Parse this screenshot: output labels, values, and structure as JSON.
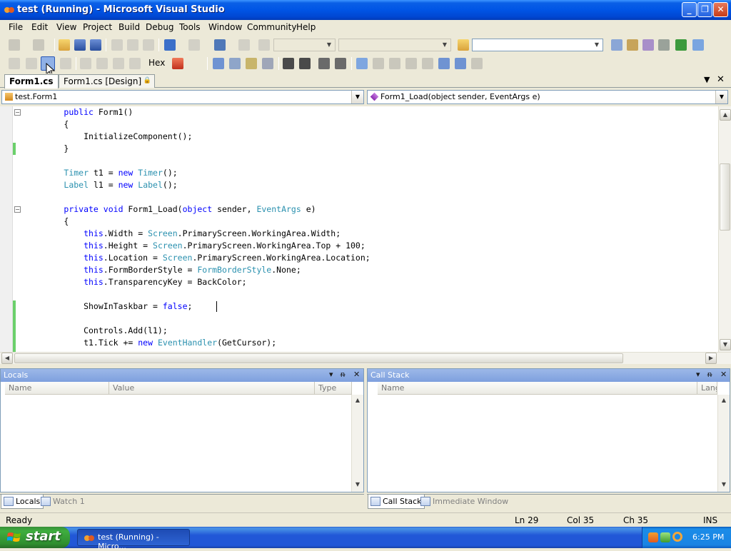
{
  "window": {
    "title": "test (Running) - Microsoft Visual Studio",
    "min_glyph": "_",
    "max_glyph": "❐",
    "close_glyph": "✕"
  },
  "menu": [
    "File",
    "Edit",
    "View",
    "Project",
    "Build",
    "Debug",
    "Tools",
    "Window",
    "Community",
    "Help"
  ],
  "debug_toolbar": {
    "hex_label": "Hex"
  },
  "document_tabs": [
    {
      "label": "Form1.cs",
      "active": true
    },
    {
      "label": "Form1.cs [Design]",
      "active": false
    }
  ],
  "navigation": {
    "class_combo": "test.Form1",
    "member_combo": "Form1_Load(object sender, EventArgs e)"
  },
  "code": [
    [
      {
        "t": "        "
      },
      {
        "t": "public",
        "c": "kw"
      },
      {
        "t": " Form1()"
      }
    ],
    [
      {
        "t": "        {"
      }
    ],
    [
      {
        "t": "            InitializeComponent();"
      }
    ],
    [
      {
        "t": "        }"
      }
    ],
    [
      {
        "t": ""
      }
    ],
    [
      {
        "t": "        "
      },
      {
        "t": "Timer",
        "c": "ty"
      },
      {
        "t": " t1 = "
      },
      {
        "t": "new",
        "c": "kw"
      },
      {
        "t": " "
      },
      {
        "t": "Timer",
        "c": "ty"
      },
      {
        "t": "();"
      }
    ],
    [
      {
        "t": "        "
      },
      {
        "t": "Label",
        "c": "ty"
      },
      {
        "t": " l1 = "
      },
      {
        "t": "new",
        "c": "kw"
      },
      {
        "t": " "
      },
      {
        "t": "Label",
        "c": "ty"
      },
      {
        "t": "();"
      }
    ],
    [
      {
        "t": ""
      }
    ],
    [
      {
        "t": "        "
      },
      {
        "t": "private",
        "c": "kw"
      },
      {
        "t": " "
      },
      {
        "t": "void",
        "c": "kw"
      },
      {
        "t": " Form1_Load("
      },
      {
        "t": "object",
        "c": "kw"
      },
      {
        "t": " sender, "
      },
      {
        "t": "EventArgs",
        "c": "ty"
      },
      {
        "t": " e)"
      }
    ],
    [
      {
        "t": "        {"
      }
    ],
    [
      {
        "t": "            "
      },
      {
        "t": "this",
        "c": "kw"
      },
      {
        "t": ".Width = "
      },
      {
        "t": "Screen",
        "c": "ty"
      },
      {
        "t": ".PrimaryScreen.WorkingArea.Width;"
      }
    ],
    [
      {
        "t": "            "
      },
      {
        "t": "this",
        "c": "kw"
      },
      {
        "t": ".Height = "
      },
      {
        "t": "Screen",
        "c": "ty"
      },
      {
        "t": ".PrimaryScreen.WorkingArea.Top + 100;"
      }
    ],
    [
      {
        "t": "            "
      },
      {
        "t": "this",
        "c": "kw"
      },
      {
        "t": ".Location = "
      },
      {
        "t": "Screen",
        "c": "ty"
      },
      {
        "t": ".PrimaryScreen.WorkingArea.Location;"
      }
    ],
    [
      {
        "t": "            "
      },
      {
        "t": "this",
        "c": "kw"
      },
      {
        "t": ".FormBorderStyle = "
      },
      {
        "t": "FormBorderStyle",
        "c": "ty"
      },
      {
        "t": ".None;"
      }
    ],
    [
      {
        "t": "            "
      },
      {
        "t": "this",
        "c": "kw"
      },
      {
        "t": ".TransparencyKey = BackColor;"
      }
    ],
    [
      {
        "t": ""
      }
    ],
    [
      {
        "t": "            ShowInTaskbar = "
      },
      {
        "t": "false",
        "c": "kw"
      },
      {
        "t": ";"
      }
    ],
    [
      {
        "t": ""
      }
    ],
    [
      {
        "t": "            Controls.Add(l1);"
      }
    ],
    [
      {
        "t": "            t1.Tick += "
      },
      {
        "t": "new",
        "c": "kw"
      },
      {
        "t": " "
      },
      {
        "t": "EventHandler",
        "c": "ty"
      },
      {
        "t": "(GetCursor);"
      }
    ]
  ],
  "locals_pane": {
    "title": "Locals",
    "columns": [
      "Name",
      "Value",
      "Type"
    ]
  },
  "callstack_pane": {
    "title": "Call Stack",
    "columns": [
      "Name",
      "Langu"
    ]
  },
  "pane_controls": {
    "dropdown": "▾",
    "pin": "ᵰ",
    "close": "✕"
  },
  "bottom_tabs_left": [
    {
      "label": "Locals",
      "active": true
    },
    {
      "label": "Watch 1",
      "active": false
    }
  ],
  "bottom_tabs_right": [
    {
      "label": "Call Stack",
      "active": true
    },
    {
      "label": "Immediate Window",
      "active": false
    }
  ],
  "status": {
    "message": "Ready",
    "line": "Ln 29",
    "col": "Col 35",
    "ch": "Ch 35",
    "mode": "INS"
  },
  "taskbar": {
    "start_label": "start",
    "task_label": "test (Running) - Micro...",
    "clock": "6:25 PM"
  },
  "colors": {
    "keyword": "#0000ff",
    "type": "#2b91af",
    "titlebar": "#0055e5",
    "start_button": "#3fae3f",
    "change_marker": "#6bd06b"
  }
}
